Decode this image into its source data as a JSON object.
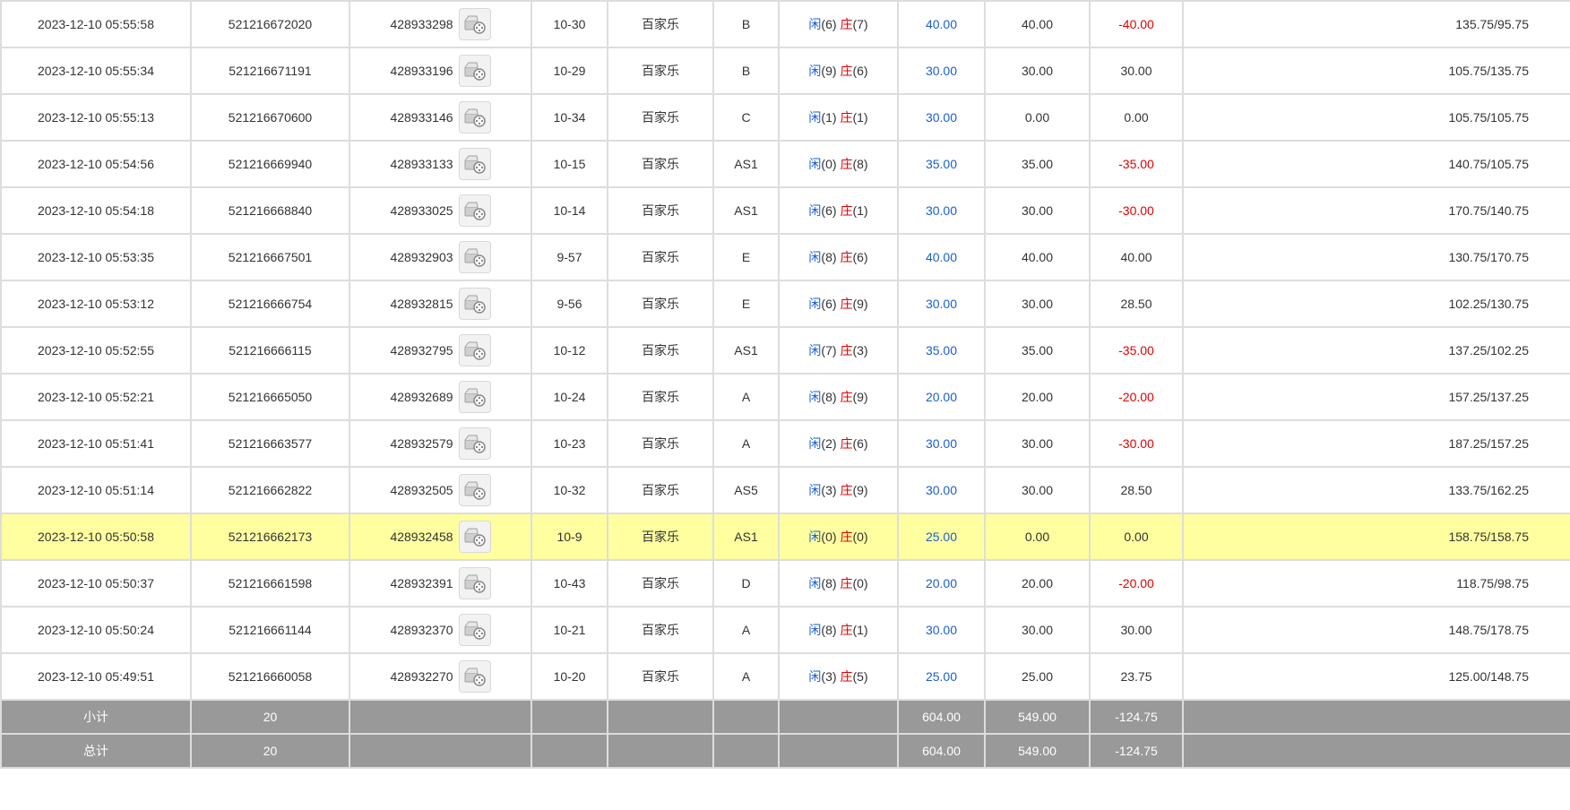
{
  "colors": {
    "player_blue": "#1a5fd0",
    "banker_red": "#e00000",
    "highlight_row": "#ffffa0",
    "summary_bg": "#999999"
  },
  "icons": {
    "video": "film-reel-icon"
  },
  "rows": [
    {
      "time": "2023-12-10 05:55:58",
      "bet_no": "521216672020",
      "round_no": "428933298",
      "table": "10-30",
      "game": "百家乐",
      "table_code": "B",
      "player_label": "闲",
      "player_pts": "(6)",
      "banker_label": "庄",
      "banker_pts": "(7)",
      "bet": "40.00",
      "valid": "40.00",
      "win": "-40.00",
      "win_neg": true,
      "balance": "135.75/95.75"
    },
    {
      "time": "2023-12-10 05:55:34",
      "bet_no": "521216671191",
      "round_no": "428933196",
      "table": "10-29",
      "game": "百家乐",
      "table_code": "B",
      "player_label": "闲",
      "player_pts": "(9)",
      "banker_label": "庄",
      "banker_pts": "(6)",
      "bet": "30.00",
      "valid": "30.00",
      "win": "30.00",
      "win_neg": false,
      "balance": "105.75/135.75"
    },
    {
      "time": "2023-12-10 05:55:13",
      "bet_no": "521216670600",
      "round_no": "428933146",
      "table": "10-34",
      "game": "百家乐",
      "table_code": "C",
      "player_label": "闲",
      "player_pts": "(1)",
      "banker_label": "庄",
      "banker_pts": "(1)",
      "bet": "30.00",
      "valid": "0.00",
      "win": "0.00",
      "win_neg": false,
      "balance": "105.75/105.75"
    },
    {
      "time": "2023-12-10 05:54:56",
      "bet_no": "521216669940",
      "round_no": "428933133",
      "table": "10-15",
      "game": "百家乐",
      "table_code": "AS1",
      "player_label": "闲",
      "player_pts": "(0)",
      "banker_label": "庄",
      "banker_pts": "(8)",
      "bet": "35.00",
      "valid": "35.00",
      "win": "-35.00",
      "win_neg": true,
      "balance": "140.75/105.75"
    },
    {
      "time": "2023-12-10 05:54:18",
      "bet_no": "521216668840",
      "round_no": "428933025",
      "table": "10-14",
      "game": "百家乐",
      "table_code": "AS1",
      "player_label": "闲",
      "player_pts": "(6)",
      "banker_label": "庄",
      "banker_pts": "(1)",
      "bet": "30.00",
      "valid": "30.00",
      "win": "-30.00",
      "win_neg": true,
      "balance": "170.75/140.75"
    },
    {
      "time": "2023-12-10 05:53:35",
      "bet_no": "521216667501",
      "round_no": "428932903",
      "table": "9-57",
      "game": "百家乐",
      "table_code": "E",
      "player_label": "闲",
      "player_pts": "(8)",
      "banker_label": "庄",
      "banker_pts": "(6)",
      "bet": "40.00",
      "valid": "40.00",
      "win": "40.00",
      "win_neg": false,
      "balance": "130.75/170.75"
    },
    {
      "time": "2023-12-10 05:53:12",
      "bet_no": "521216666754",
      "round_no": "428932815",
      "table": "9-56",
      "game": "百家乐",
      "table_code": "E",
      "player_label": "闲",
      "player_pts": "(6)",
      "banker_label": "庄",
      "banker_pts": "(9)",
      "bet": "30.00",
      "valid": "30.00",
      "win": "28.50",
      "win_neg": false,
      "balance": "102.25/130.75"
    },
    {
      "time": "2023-12-10 05:52:55",
      "bet_no": "521216666115",
      "round_no": "428932795",
      "table": "10-12",
      "game": "百家乐",
      "table_code": "AS1",
      "player_label": "闲",
      "player_pts": "(7)",
      "banker_label": "庄",
      "banker_pts": "(3)",
      "bet": "35.00",
      "valid": "35.00",
      "win": "-35.00",
      "win_neg": true,
      "balance": "137.25/102.25"
    },
    {
      "time": "2023-12-10 05:52:21",
      "bet_no": "521216665050",
      "round_no": "428932689",
      "table": "10-24",
      "game": "百家乐",
      "table_code": "A",
      "player_label": "闲",
      "player_pts": "(8)",
      "banker_label": "庄",
      "banker_pts": "(9)",
      "bet": "20.00",
      "valid": "20.00",
      "win": "-20.00",
      "win_neg": true,
      "balance": "157.25/137.25"
    },
    {
      "time": "2023-12-10 05:51:41",
      "bet_no": "521216663577",
      "round_no": "428932579",
      "table": "10-23",
      "game": "百家乐",
      "table_code": "A",
      "player_label": "闲",
      "player_pts": "(2)",
      "banker_label": "庄",
      "banker_pts": "(6)",
      "bet": "30.00",
      "valid": "30.00",
      "win": "-30.00",
      "win_neg": true,
      "balance": "187.25/157.25"
    },
    {
      "time": "2023-12-10 05:51:14",
      "bet_no": "521216662822",
      "round_no": "428932505",
      "table": "10-32",
      "game": "百家乐",
      "table_code": "AS5",
      "player_label": "闲",
      "player_pts": "(3)",
      "banker_label": "庄",
      "banker_pts": "(9)",
      "bet": "30.00",
      "valid": "30.00",
      "win": "28.50",
      "win_neg": false,
      "balance": "133.75/162.25"
    },
    {
      "time": "2023-12-10 05:50:58",
      "bet_no": "521216662173",
      "round_no": "428932458",
      "table": "10-9",
      "game": "百家乐",
      "table_code": "AS1",
      "player_label": "闲",
      "player_pts": "(0)",
      "banker_label": "庄",
      "banker_pts": "(0)",
      "bet": "25.00",
      "valid": "0.00",
      "win": "0.00",
      "win_neg": false,
      "balance": "158.75/158.75",
      "highlight": true
    },
    {
      "time": "2023-12-10 05:50:37",
      "bet_no": "521216661598",
      "round_no": "428932391",
      "table": "10-43",
      "game": "百家乐",
      "table_code": "D",
      "player_label": "闲",
      "player_pts": "(8)",
      "banker_label": "庄",
      "banker_pts": "(0)",
      "bet": "20.00",
      "valid": "20.00",
      "win": "-20.00",
      "win_neg": true,
      "balance": "118.75/98.75"
    },
    {
      "time": "2023-12-10 05:50:24",
      "bet_no": "521216661144",
      "round_no": "428932370",
      "table": "10-21",
      "game": "百家乐",
      "table_code": "A",
      "player_label": "闲",
      "player_pts": "(8)",
      "banker_label": "庄",
      "banker_pts": "(1)",
      "bet": "30.00",
      "valid": "30.00",
      "win": "30.00",
      "win_neg": false,
      "balance": "148.75/178.75"
    },
    {
      "time": "2023-12-10 05:49:51",
      "bet_no": "521216660058",
      "round_no": "428932270",
      "table": "10-20",
      "game": "百家乐",
      "table_code": "A",
      "player_label": "闲",
      "player_pts": "(3)",
      "banker_label": "庄",
      "banker_pts": "(5)",
      "bet": "25.00",
      "valid": "25.00",
      "win": "23.75",
      "win_neg": false,
      "balance": "125.00/148.75"
    }
  ],
  "summary": [
    {
      "label": "小计",
      "count": "20",
      "bet": "604.00",
      "valid": "549.00",
      "win": "-124.75"
    },
    {
      "label": "总计",
      "count": "20",
      "bet": "604.00",
      "valid": "549.00",
      "win": "-124.75"
    }
  ]
}
